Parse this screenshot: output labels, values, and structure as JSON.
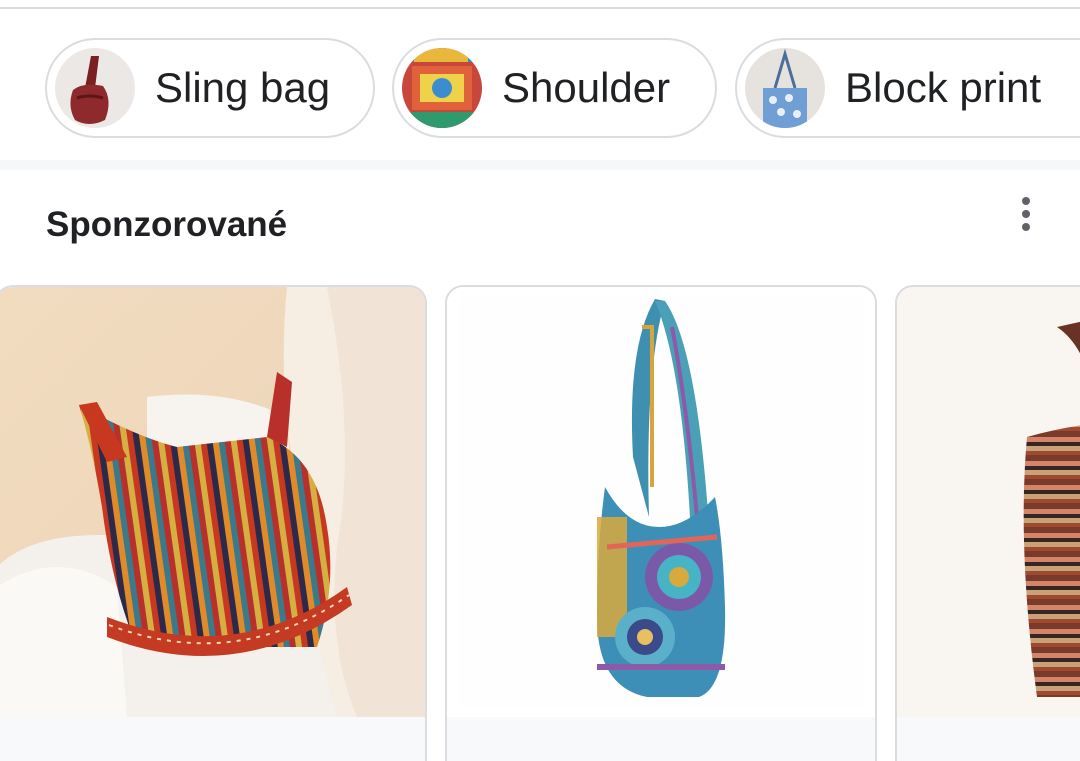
{
  "chips": [
    {
      "label": "Sling bag",
      "thumb": "sling-bag-thumbnail"
    },
    {
      "label": "Shoulder",
      "thumb": "shoulder-bag-thumbnail"
    },
    {
      "label": "Block print",
      "thumb": "block-print-bag-thumbnail"
    }
  ],
  "section": {
    "title": "Sponzorované",
    "menu_icon": "more-vert-icon"
  },
  "products": [
    {
      "image": "striped-red-sling-bag-photo"
    },
    {
      "image": "blue-mandala-hobo-bag-photo"
    },
    {
      "image": "brown-striped-bag-photo"
    }
  ]
}
